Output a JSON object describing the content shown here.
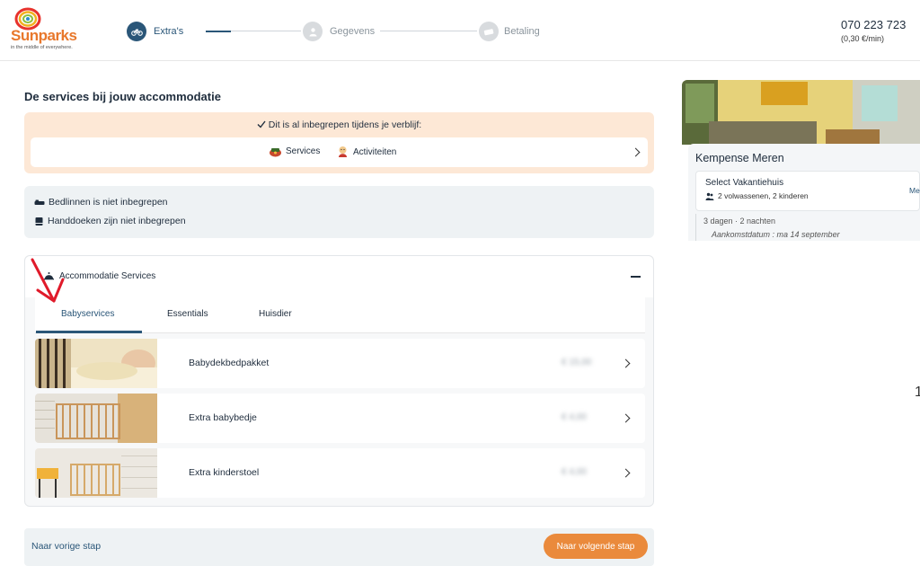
{
  "brand": {
    "name": "Sunparks",
    "tagline": "in the middle of everywhere.",
    "colors": {
      "primary": "#2a5678",
      "accent": "#ea8a3c",
      "brand_orange": "#e8782c"
    }
  },
  "progress": {
    "steps": [
      {
        "label": "Extra's",
        "icon": "bicycle-icon",
        "active": true
      },
      {
        "label": "Gegevens",
        "icon": "person-icon",
        "active": false
      },
      {
        "label": "Betaling",
        "icon": "ticket-icon",
        "active": false
      }
    ]
  },
  "contact": {
    "phone": "070 223 723",
    "rate": "(0,30 €/min)"
  },
  "main": {
    "section_title": "De services bij jouw accommodatie",
    "included": {
      "heading": "Dit is al inbegrepen tijdens je verblijf:",
      "items": [
        {
          "label": "Services",
          "icon": "services-icon"
        },
        {
          "label": "Activiteiten",
          "icon": "activities-icon"
        }
      ]
    },
    "not_included": [
      {
        "label": "Bedlinnen is niet inbegrepen",
        "icon": "bed-icon"
      },
      {
        "label": "Handdoeken zijn niet inbegrepen",
        "icon": "towel-icon"
      }
    ],
    "accommodation_services": {
      "title": "Accommodatie Services",
      "tabs": [
        {
          "label": "Babyservices",
          "active": true
        },
        {
          "label": "Essentials",
          "active": false
        },
        {
          "label": "Huisdier",
          "active": false
        }
      ],
      "services": [
        {
          "name": "Babydekbedpakket",
          "price": "€ 15,00"
        },
        {
          "name": "Extra babybedje",
          "price": "€ 4,00"
        },
        {
          "name": "Extra kinderstoel",
          "price": "€ 4,00"
        }
      ]
    },
    "nav": {
      "prev": "Naar vorige stap",
      "next": "Naar volgende stap"
    }
  },
  "summary": {
    "park": "Kempense Meren",
    "accommodation": "Select Vakantiehuis",
    "guests": "2 volwassenen, 2 kinderen",
    "more": "Me",
    "stay": "3 dagen · 2 nachten",
    "arrival": "Aankomstdatum : ma 14 september"
  },
  "edge_glyph": "1"
}
